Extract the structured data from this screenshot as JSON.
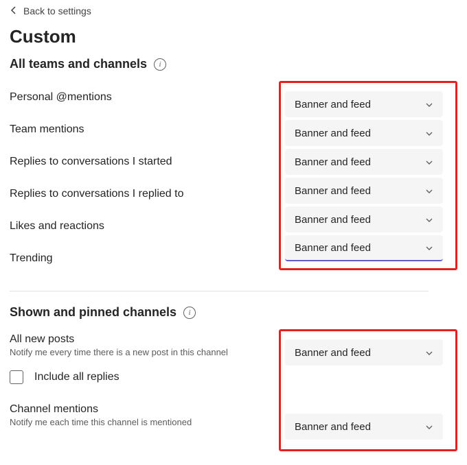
{
  "nav": {
    "back_label": "Back to settings"
  },
  "page": {
    "title": "Custom"
  },
  "section_all": {
    "title": "All teams and channels",
    "info_glyph": "i",
    "rows": [
      {
        "label": "Personal @mentions",
        "value": "Banner and feed"
      },
      {
        "label": "Team mentions",
        "value": "Banner and feed"
      },
      {
        "label": "Replies to conversations I started",
        "value": "Banner and feed"
      },
      {
        "label": "Replies to conversations I replied to",
        "value": "Banner and feed"
      },
      {
        "label": "Likes and reactions",
        "value": "Banner and feed"
      },
      {
        "label": "Trending",
        "value": "Banner and feed"
      }
    ]
  },
  "section_pinned": {
    "title": "Shown and pinned channels",
    "info_glyph": "i",
    "all_new_posts": {
      "label": "All new posts",
      "sublabel": "Notify me every time there is a new post in this channel",
      "value": "Banner and feed"
    },
    "include_replies": {
      "label": "Include all replies",
      "checked": false
    },
    "channel_mentions": {
      "label": "Channel mentions",
      "sublabel": "Notify me each time this channel is mentioned",
      "value": "Banner and feed"
    }
  }
}
